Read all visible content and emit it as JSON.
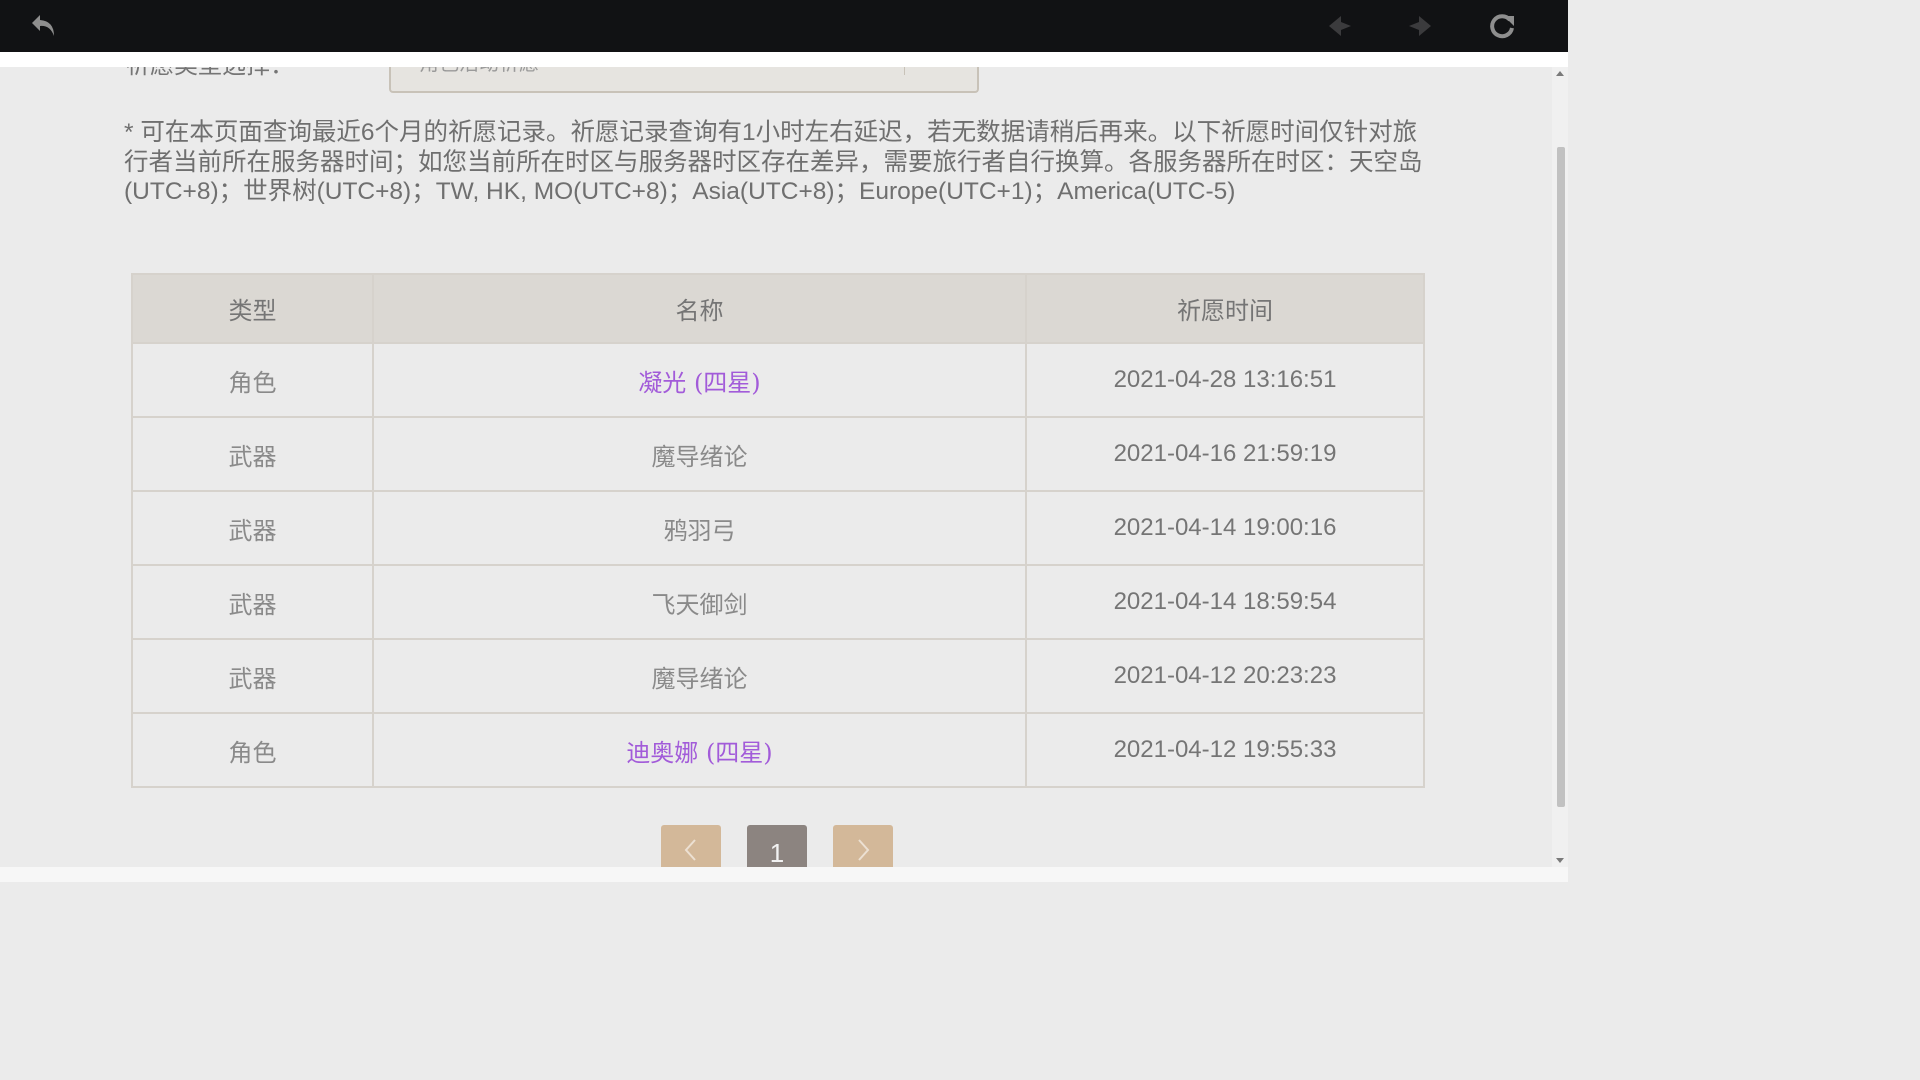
{
  "toolbar": {
    "icons": [
      "back-icon",
      "prev-page-icon",
      "next-page-icon",
      "reload-icon"
    ]
  },
  "filter": {
    "label": "祈愿类型选择：",
    "selected": "角色活动祈愿"
  },
  "notice": "* 可在本页面查询最近6个月的祈愿记录。祈愿记录查询有1小时左右延迟，若无数据请稍后再来。以下祈愿时间仅针对旅行者当前所在服务器时间；如您当前所在时区与服务器时区存在差异，需要旅行者自行换算。各服务器所在时区：天空岛(UTC+8)；世界树(UTC+8)；TW, HK, MO(UTC+8)；Asia(UTC+8)；Europe(UTC+1)；America(UTC-5)",
  "table": {
    "headers": [
      "类型",
      "名称",
      "祈愿时间"
    ],
    "rows": [
      {
        "type": "角色",
        "name": "凝光 (四星)",
        "time": "2021-04-28 13:16:51"
      },
      {
        "type": "武器",
        "name": "魔导绪论",
        "time": "2021-04-16 21:59:19"
      },
      {
        "type": "武器",
        "name": "鸦羽弓",
        "time": "2021-04-14 19:00:16"
      },
      {
        "type": "武器",
        "name": "飞天御剑",
        "time": "2021-04-14 18:59:54"
      },
      {
        "type": "武器",
        "name": "魔导绪论",
        "time": "2021-04-12 20:23:23"
      },
      {
        "type": "角色",
        "name": "迪奥娜 (四星)",
        "time": "2021-04-12 19:55:33"
      }
    ]
  },
  "pagination": {
    "current_page": "1",
    "prev_icon": "chevron-left-icon",
    "next_icon": "chevron-right-icon"
  },
  "colors": {
    "topbar": "#111214",
    "page_bg": "#ebebeb",
    "header_bg": "#dbd8d3",
    "four_star_purple": "#a25bd9",
    "pager_tan": "#d3b899",
    "pager_current": "#8c8480"
  }
}
